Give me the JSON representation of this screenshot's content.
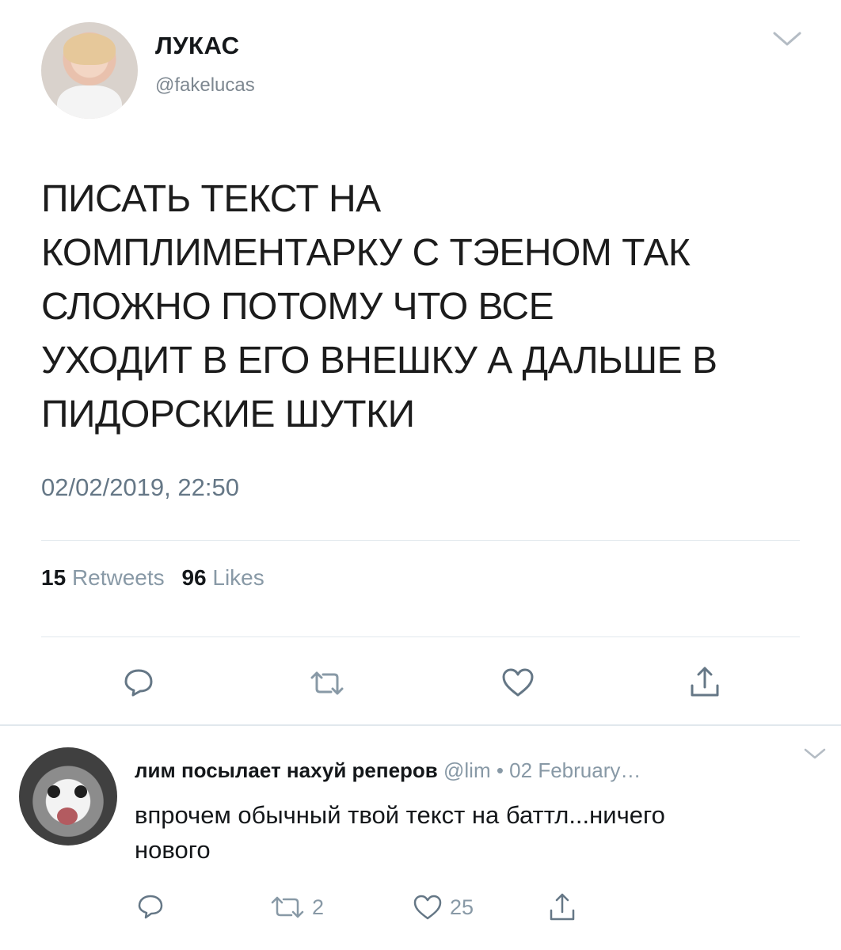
{
  "tweet": {
    "author_name": "ЛУКАС",
    "author_handle": "@fakelucas",
    "text_lines": [
      "ПИСАТЬ ТЕКСТ НА",
      "КОМПЛИМЕНТАРКУ С ТЭЕНОМ ТАК",
      "СЛОЖНО ПОТОМУ ЧТО ВСЕ",
      "УХОДИТ В ЕГО ВНЕШКУ А ДАЛЬШЕ В",
      "ПИДОРСКИЕ ШУТКИ"
    ],
    "datetime": "02/02/2019, 22:50",
    "retweets_count": "15",
    "retweets_label": "Retweets",
    "likes_count": "96",
    "likes_label": "Likes",
    "icons": {
      "menu": "chevron-down-icon",
      "reply": "reply-icon",
      "retweet": "retweet-icon",
      "like": "heart-icon",
      "share": "share-icon"
    }
  },
  "reply": {
    "author_name": "лим посылает нахуй реперов",
    "meta": "@lim • 02 February…",
    "text_line1": "впрочем обычный твой текст на баттл...ничего",
    "text_line2": "нового",
    "retweets": "2",
    "likes": "25"
  },
  "colors": {
    "text": "#14171a",
    "muted": "#8899a6",
    "divider": "#e1e8ed"
  }
}
